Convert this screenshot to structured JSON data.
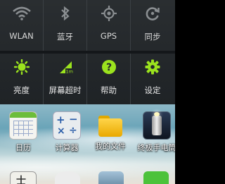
{
  "quick_settings": {
    "row1": [
      {
        "label": "WLAN",
        "icon": "wifi-icon"
      },
      {
        "label": "蓝牙",
        "icon": "bluetooth-icon"
      },
      {
        "label": "GPS",
        "icon": "gps-icon"
      },
      {
        "label": "同步",
        "icon": "sync-icon"
      }
    ],
    "row2": [
      {
        "label": "亮度",
        "icon": "brightness-icon"
      },
      {
        "label": "屏幕超时",
        "icon": "screen-timeout-icon"
      },
      {
        "label": "帮助",
        "icon": "help-icon"
      },
      {
        "label": "设定",
        "icon": "settings-icon"
      }
    ]
  },
  "home": {
    "apps": [
      {
        "label": "日历",
        "icon": "calendar-icon"
      },
      {
        "label": "计算器",
        "icon": "calculator-icon"
      },
      {
        "label": "我的文件",
        "icon": "folder-icon"
      },
      {
        "label": "终极手电筒",
        "icon": "flashlight-icon"
      }
    ]
  },
  "colors": {
    "accent_green": "#9be31e",
    "inactive_icon": "#8a8e91",
    "panel_bg": "#24282b"
  }
}
